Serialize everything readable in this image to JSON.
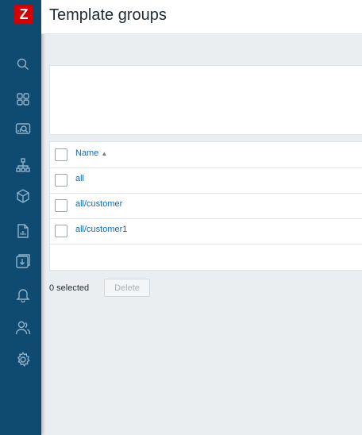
{
  "app": {
    "logo_text": "Z",
    "brand_color": "#d40000",
    "sidebar_color": "#0f4a71"
  },
  "header": {
    "title": "Template groups"
  },
  "sidebar": {
    "items": [
      {
        "icon": "search-icon"
      },
      {
        "icon": "dashboard-icon"
      },
      {
        "icon": "monitoring-icon"
      },
      {
        "icon": "network-icon"
      },
      {
        "icon": "inventory-icon"
      },
      {
        "icon": "reports-icon"
      },
      {
        "icon": "data-collection-icon"
      },
      {
        "icon": "alerts-icon"
      },
      {
        "icon": "users-icon"
      },
      {
        "icon": "settings-icon"
      }
    ]
  },
  "table": {
    "columns": [
      {
        "label": "Name",
        "sorted": "asc",
        "sort_glyph": "▲"
      }
    ],
    "rows": [
      {
        "name": "all"
      },
      {
        "name": "all/customer"
      },
      {
        "name": "all/customer1"
      }
    ]
  },
  "footer": {
    "selected_text": "0 selected",
    "delete_label": "Delete"
  }
}
